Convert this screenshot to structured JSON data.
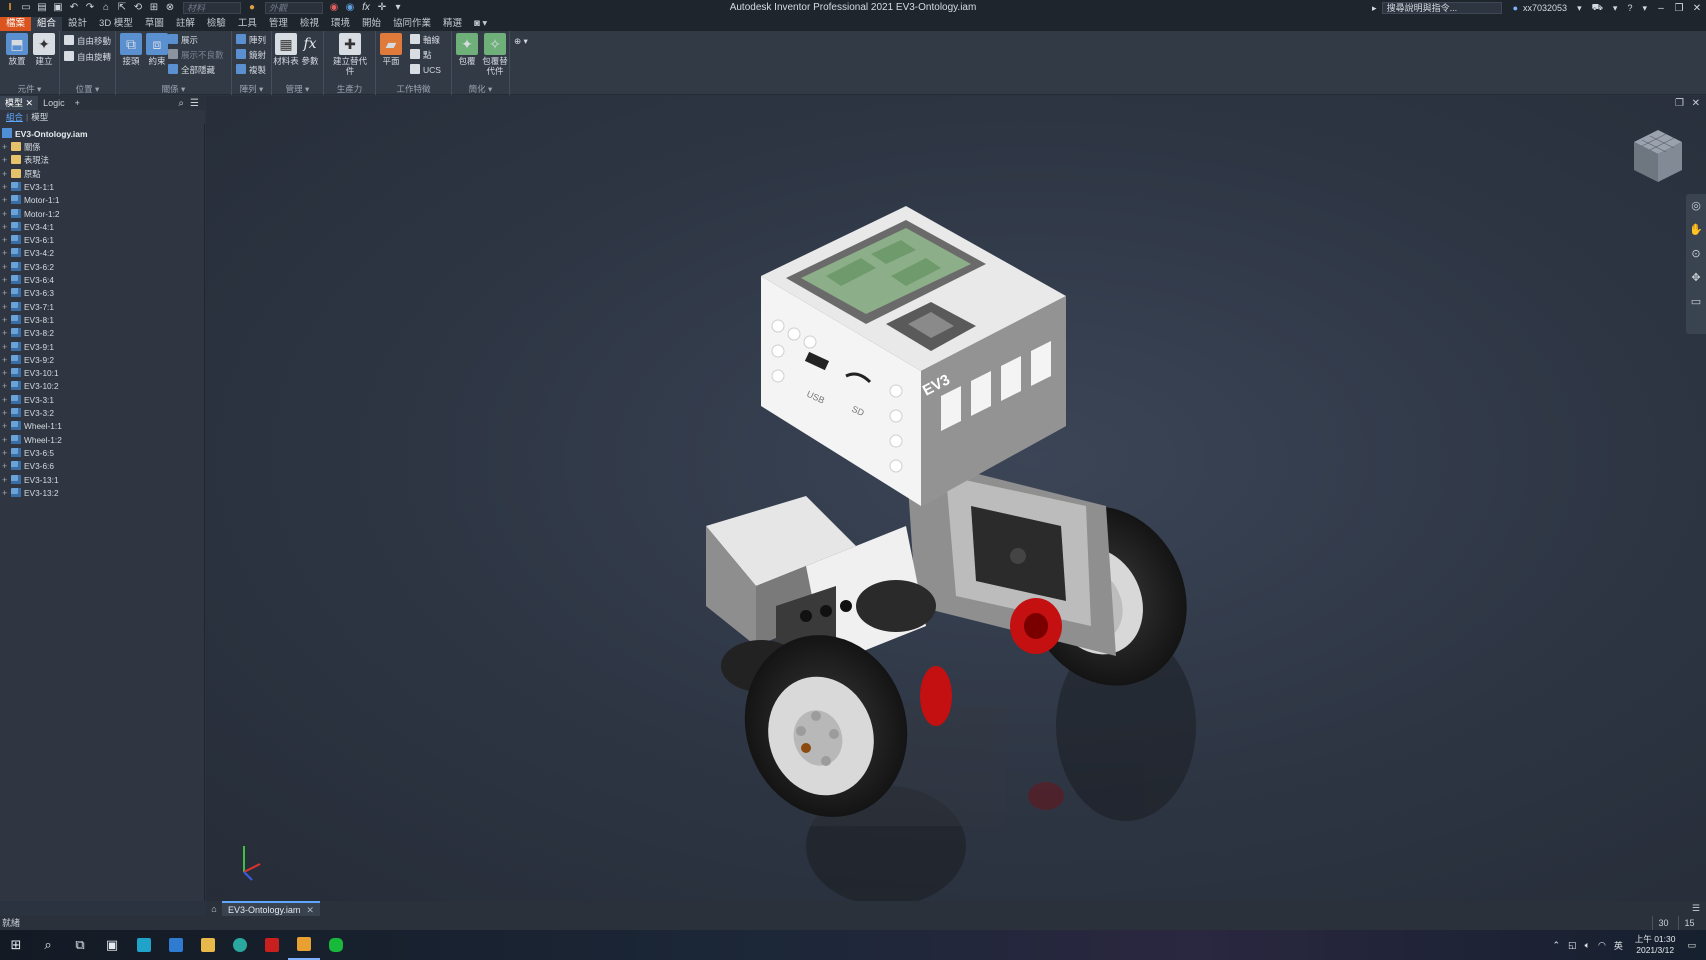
{
  "window": {
    "title": "Autodesk Inventor Professional 2021   EV3-Ontology.iam",
    "quick_access": {
      "material_placeholder": "材料",
      "appearance_placeholder": "外觀"
    },
    "help_search": "搜尋說明與指令...",
    "user": "xx7032053"
  },
  "ribbon": {
    "tabs": [
      "檔案",
      "組合",
      "設計",
      "3D 模型",
      "草圖",
      "註解",
      "檢驗",
      "工具",
      "管理",
      "檢視",
      "環境",
      "開始",
      "協同作業",
      "精選"
    ],
    "active_tab": "組合",
    "panels": [
      {
        "title": "元件 ▾",
        "buttons": [
          "放置",
          "建立"
        ]
      },
      {
        "title": "位置 ▾",
        "buttons": [
          "自由移動",
          "自由旋轉"
        ]
      },
      {
        "title": "關係 ▾",
        "buttons": [
          "接頭",
          "約束",
          "展示",
          "展示不良數",
          "全部隱藏"
        ]
      },
      {
        "title": "陣列 ▾",
        "buttons": [
          "陣列",
          "鏡射",
          "複製"
        ]
      },
      {
        "title": "管理 ▾",
        "buttons": [
          "材料表",
          "參數"
        ]
      },
      {
        "title": "生產力",
        "buttons": [
          "建立替代件"
        ]
      },
      {
        "title": "工作特徵",
        "buttons": [
          "平面",
          "軸線",
          "點",
          "UCS"
        ]
      },
      {
        "title": "簡化 ▾",
        "buttons": [
          "包覆",
          "包覆替代件"
        ]
      }
    ]
  },
  "browser": {
    "tabs": [
      "模型",
      "Logic"
    ],
    "add_label": "+",
    "sub": {
      "view1": "組合",
      "view2": "模型"
    },
    "root": "EV3-Ontology.iam",
    "items": [
      {
        "label": "關係",
        "icon": "folder"
      },
      {
        "label": "表現法",
        "icon": "folder"
      },
      {
        "label": "原點",
        "icon": "folder"
      },
      {
        "label": "EV3-1:1",
        "icon": "asm"
      },
      {
        "label": "Motor-1:1",
        "icon": "asm"
      },
      {
        "label": "Motor-1:2",
        "icon": "asm"
      },
      {
        "label": "EV3-4:1",
        "icon": "asm"
      },
      {
        "label": "EV3-6:1",
        "icon": "asm"
      },
      {
        "label": "EV3-4:2",
        "icon": "asm"
      },
      {
        "label": "EV3-6:2",
        "icon": "asm"
      },
      {
        "label": "EV3-6:4",
        "icon": "asm"
      },
      {
        "label": "EV3-6:3",
        "icon": "asm"
      },
      {
        "label": "EV3-7:1",
        "icon": "asm"
      },
      {
        "label": "EV3-8:1",
        "icon": "asm"
      },
      {
        "label": "EV3-8:2",
        "icon": "asm"
      },
      {
        "label": "EV3-9:1",
        "icon": "asm"
      },
      {
        "label": "EV3-9:2",
        "icon": "asm"
      },
      {
        "label": "EV3-10:1",
        "icon": "asm"
      },
      {
        "label": "EV3-10:2",
        "icon": "asm"
      },
      {
        "label": "EV3-3:1",
        "icon": "asm"
      },
      {
        "label": "EV3-3:2",
        "icon": "asm"
      },
      {
        "label": "Wheel-1:1",
        "icon": "asm"
      },
      {
        "label": "Wheel-1:2",
        "icon": "asm"
      },
      {
        "label": "EV3-6:5",
        "icon": "asm"
      },
      {
        "label": "EV3-6:6",
        "icon": "asm"
      },
      {
        "label": "EV3-13:1",
        "icon": "asm"
      },
      {
        "label": "EV3-13:2",
        "icon": "asm"
      }
    ]
  },
  "viewport": {
    "model_labels": {
      "brand": "EV3",
      "usb": "USB",
      "sd": "SD"
    }
  },
  "document_tabs": [
    {
      "label": "EV3-Ontology.iam",
      "active": true
    }
  ],
  "status": {
    "text": "就緒",
    "count1": "30",
    "count2": "15"
  },
  "taskbar": {
    "clock_time": "上午 01:30",
    "clock_date": "2021/3/12",
    "ime": "英"
  },
  "colors": {
    "file_tab": "#d9541e",
    "background": "#2b3340",
    "accent": "#5fa6ff"
  }
}
